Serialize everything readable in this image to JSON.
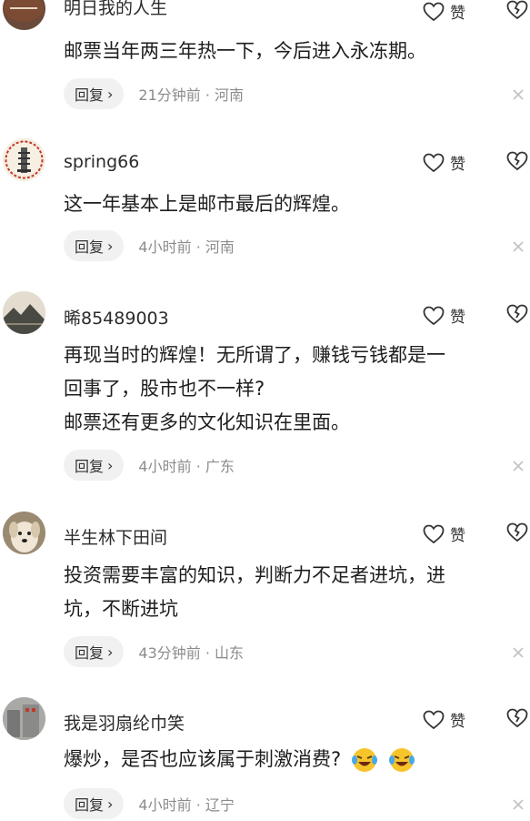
{
  "actions": {
    "like_label": "赞",
    "reply_label": "回复",
    "reply_chevron": "›"
  },
  "comments": [
    {
      "username": "明日我的人生",
      "text": "邮票当年两三年热一下，今后进入永冻期。",
      "time": "21分钟前 · 河南",
      "avatar_icon": "football-avatar"
    },
    {
      "username": "spring66",
      "text": "这一年基本上是邮市最后的辉煌。",
      "time": "4小时前 · 河南",
      "avatar_icon": "pagoda-avatar"
    },
    {
      "username": "晞85489003",
      "text_lines": [
        "再现当时的辉煌！无所谓了，赚钱亏钱都是一",
        "回事了，股市也不一样?",
        "邮票还有更多的文化知识在里面。"
      ],
      "time": "4小时前 · 广东",
      "avatar_icon": "ink-landscape-avatar"
    },
    {
      "username": "半生林下田间",
      "text_lines": [
        "投资需要丰富的知识，判断力不足者进坑，进",
        "坑，不断进坑"
      ],
      "time": "43分钟前 · 山东",
      "avatar_icon": "dog-avatar"
    },
    {
      "username": "我是羽扇纶巾笑",
      "text": "爆炒，是否也应该属于刺激消费?",
      "time": "4小时前 · 辽宁",
      "avatar_icon": "building-avatar",
      "emojis": [
        "laughing-crying-emoji",
        "laughing-crying-emoji"
      ]
    }
  ]
}
